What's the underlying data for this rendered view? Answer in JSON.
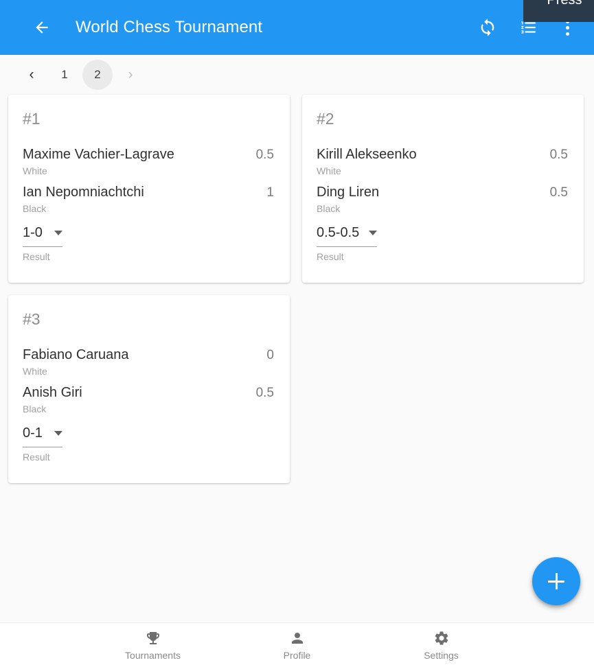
{
  "appbar": {
    "title": "World Chess Tournament",
    "back_icon": "arrow-back-icon",
    "sync_label": "sync-icon",
    "list_label": "format-list-numbered-icon",
    "menu_label": "overflow-menu-icon",
    "accent_color": "#2196f3"
  },
  "tooltip": {
    "text": "Press",
    "background": "#2b3a4a"
  },
  "pagination": {
    "prev_label": "‹",
    "next_label": "›",
    "pages": [
      "1",
      "2"
    ],
    "current": "2",
    "active_background": "#eaeaea"
  },
  "labels": {
    "white": "White",
    "black": "Black",
    "result": "Result"
  },
  "matches": [
    {
      "index": "#1",
      "white_name": "Maxime Vachier-Lagrave",
      "white_score": "0.5",
      "black_name": "Ian Nepomniachtchi",
      "black_score": "1",
      "result": "1-0"
    },
    {
      "index": "#2",
      "white_name": "Kirill Alekseenko",
      "white_score": "0.5",
      "black_name": "Ding Liren",
      "black_score": "0.5",
      "result": "0.5-0.5"
    },
    {
      "index": "#3",
      "white_name": "Fabiano Caruana",
      "white_score": "0",
      "black_name": "Anish Giri",
      "black_score": "0.5",
      "result": "0-1"
    }
  ],
  "fab": {
    "label": "+",
    "color": "#2196f3"
  },
  "bottomnav": {
    "items": [
      {
        "label": "Tournaments",
        "icon": "trophy-icon"
      },
      {
        "label": "Profile",
        "icon": "person-icon"
      },
      {
        "label": "Settings",
        "icon": "gear-icon"
      }
    ]
  }
}
